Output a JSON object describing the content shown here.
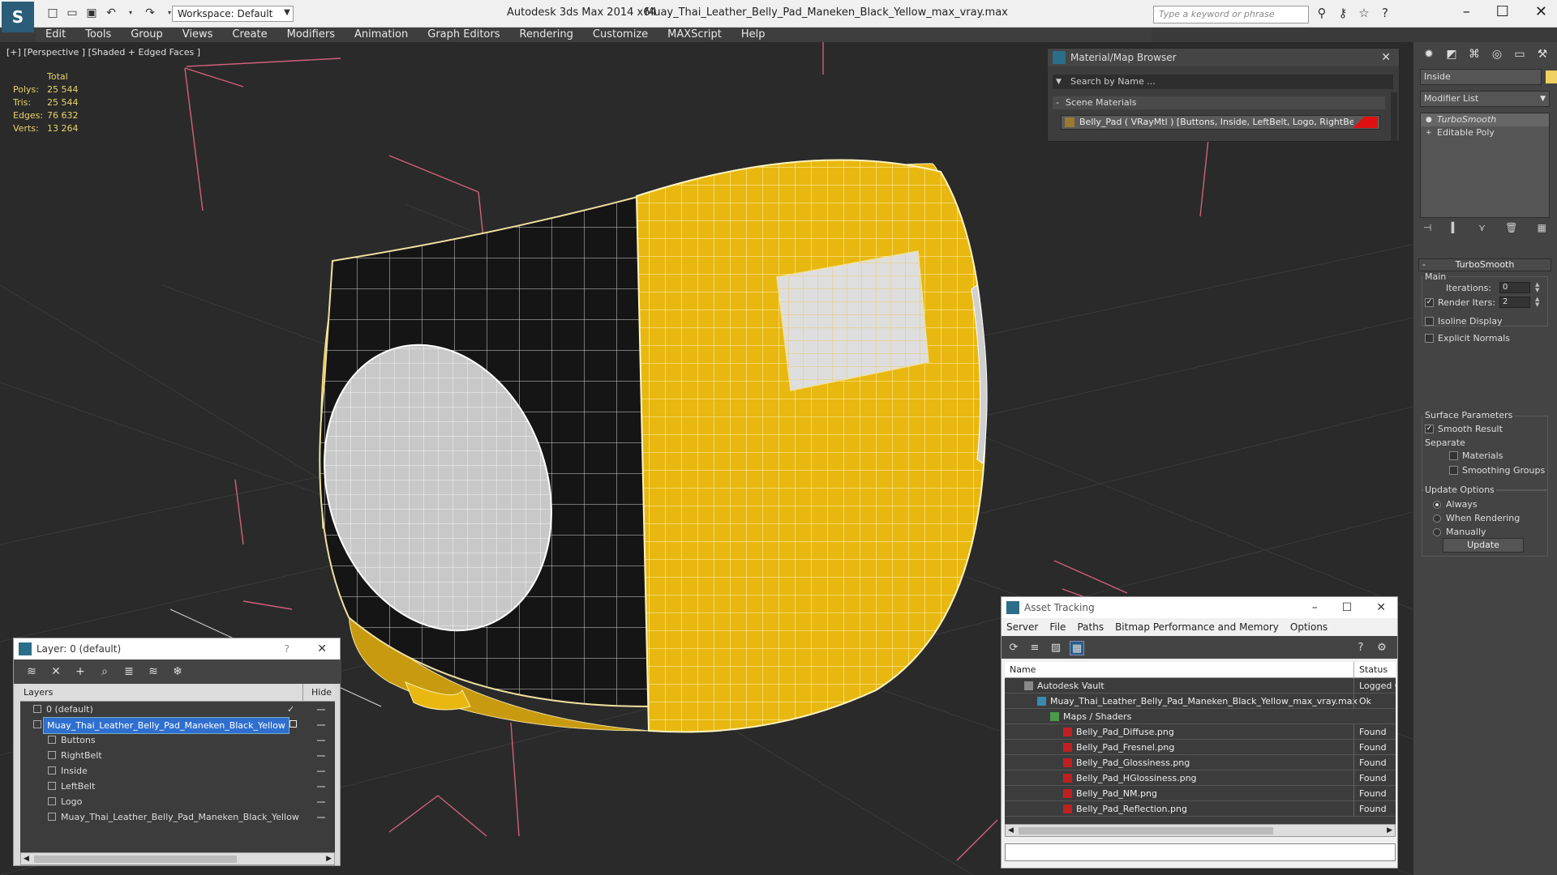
{
  "titlebar": {
    "workspace": "Workspace: Default",
    "app_name": "Autodesk 3ds Max  2014 x64",
    "file_name": "Muay_Thai_Leather_Belly_Pad_Maneken_Black_Yellow_max_vray.max",
    "search_placeholder": "Type a keyword or phrase"
  },
  "menu": [
    "Edit",
    "Tools",
    "Group",
    "Views",
    "Create",
    "Modifiers",
    "Animation",
    "Graph Editors",
    "Rendering",
    "Customize",
    "MAXScript",
    "Help"
  ],
  "viewport": {
    "label": "[+] [Perspective ] [Shaded + Edged Faces ]",
    "stats": {
      "header": "Total",
      "rows": [
        {
          "k": "Polys:",
          "v": "25 544"
        },
        {
          "k": "Tris:",
          "v": "25 544"
        },
        {
          "k": "Edges:",
          "v": "76 632"
        },
        {
          "k": "Verts:",
          "v": "13 264"
        }
      ]
    }
  },
  "material_browser": {
    "title": "Material/Map Browser",
    "search_placeholder": "Search by Name ...",
    "section": "Scene Materials",
    "item": "Belly_Pad  ( VRayMtl ) [Buttons, Inside, LeftBelt, Logo, RightBelt]"
  },
  "command_panel": {
    "object_name": "Inside",
    "modifier_list": "Modifier List",
    "stack": [
      "TurboSmooth",
      "Editable Poly"
    ],
    "rollout": "TurboSmooth",
    "main_label": "Main",
    "iterations_label": "Iterations:",
    "iterations_value": "0",
    "render_iters_label": "Render Iters:",
    "render_iters_value": "2",
    "isoline_label": "Isoline Display",
    "explicit_label": "Explicit Normals",
    "surface_label": "Surface Parameters",
    "smooth_label": "Smooth Result",
    "separate_label": "Separate",
    "materials_label": "Materials",
    "smoothing_label": "Smoothing Groups",
    "update_options_label": "Update Options",
    "always_label": "Always",
    "when_rendering_label": "When Rendering",
    "manually_label": "Manually",
    "update_button": "Update"
  },
  "layer_panel": {
    "title": "Layer: 0 (default)",
    "help": "?",
    "col_layers": "Layers",
    "col_hide": "Hide",
    "rows": [
      {
        "label": "0 (default)",
        "indent": 1,
        "checked": true
      },
      {
        "label": "Muay_Thai_Leather_Belly_Pad_Maneken_Black_Yellow",
        "indent": 1,
        "selected": true
      },
      {
        "label": "Buttons",
        "indent": 2
      },
      {
        "label": "RightBelt",
        "indent": 2
      },
      {
        "label": "Inside",
        "indent": 2
      },
      {
        "label": "LeftBelt",
        "indent": 2
      },
      {
        "label": "Logo",
        "indent": 2
      },
      {
        "label": "Muay_Thai_Leather_Belly_Pad_Maneken_Black_Yellow",
        "indent": 2
      }
    ]
  },
  "asset_tracking": {
    "title": "Asset Tracking",
    "menu": [
      "Server",
      "File",
      "Paths",
      "Bitmap Performance and Memory",
      "Options"
    ],
    "col_name": "Name",
    "col_status": "Status",
    "rows": [
      {
        "name": "Autodesk Vault",
        "status": "Logged Out",
        "level": 1
      },
      {
        "name": "Muay_Thai_Leather_Belly_Pad_Maneken_Black_Yellow_max_vray.max",
        "status": "Ok",
        "level": 2
      },
      {
        "name": "Maps / Shaders",
        "status": "",
        "level": 3
      },
      {
        "name": "Belly_Pad_Diffuse.png",
        "status": "Found",
        "level": 4
      },
      {
        "name": "Belly_Pad_Fresnel.png",
        "status": "Found",
        "level": 4
      },
      {
        "name": "Belly_Pad_Glossiness.png",
        "status": "Found",
        "level": 4
      },
      {
        "name": "Belly_Pad_HGlossiness.png",
        "status": "Found",
        "level": 4
      },
      {
        "name": "Belly_Pad_NM.png",
        "status": "Found",
        "level": 4
      },
      {
        "name": "Belly_Pad_Reflection.png",
        "status": "Found",
        "level": 4
      }
    ]
  },
  "colors": {
    "yellow": "#e8b810",
    "black_mesh": "#151515",
    "white_mesh": "#c8c8c8",
    "selection": "#2f6fd0"
  }
}
